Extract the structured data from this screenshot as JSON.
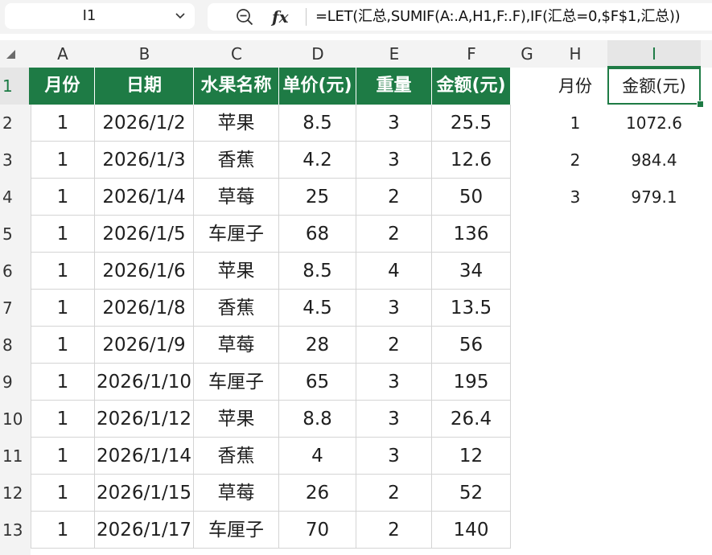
{
  "name_box": {
    "value": "I1"
  },
  "formula_bar": {
    "fx_label": "fx",
    "formula": "=LET(汇总,SUMIF(A:.A,H1,F:.F),IF(汇总=0,$F$1,汇总))"
  },
  "columns": [
    "A",
    "B",
    "C",
    "D",
    "E",
    "F",
    "G",
    "H",
    "I"
  ],
  "active_column": "I",
  "rows": [
    "1",
    "2",
    "3",
    "4",
    "5",
    "6",
    "7",
    "8",
    "9",
    "10",
    "11",
    "12",
    "13"
  ],
  "active_row": "1",
  "table": {
    "headers": [
      "月份",
      "日期",
      "水果名称",
      "单价(元)",
      "重量",
      "金额(元)"
    ],
    "rows": [
      [
        "1",
        "2026/1/2",
        "苹果",
        "8.5",
        "3",
        "25.5"
      ],
      [
        "1",
        "2026/1/3",
        "香蕉",
        "4.2",
        "3",
        "12.6"
      ],
      [
        "1",
        "2026/1/4",
        "草莓",
        "25",
        "2",
        "50"
      ],
      [
        "1",
        "2026/1/5",
        "车厘子",
        "68",
        "2",
        "136"
      ],
      [
        "1",
        "2026/1/6",
        "苹果",
        "8.5",
        "4",
        "34"
      ],
      [
        "1",
        "2026/1/8",
        "香蕉",
        "4.5",
        "3",
        "13.5"
      ],
      [
        "1",
        "2026/1/9",
        "草莓",
        "28",
        "2",
        "56"
      ],
      [
        "1",
        "2026/1/10",
        "车厘子",
        "65",
        "3",
        "195"
      ],
      [
        "1",
        "2026/1/12",
        "苹果",
        "8.8",
        "3",
        "26.4"
      ],
      [
        "1",
        "2026/1/14",
        "香蕉",
        "4",
        "3",
        "12"
      ],
      [
        "1",
        "2026/1/15",
        "草莓",
        "26",
        "2",
        "52"
      ],
      [
        "1",
        "2026/1/17",
        "车厘子",
        "70",
        "2",
        "140"
      ]
    ]
  },
  "summary": {
    "headers": [
      "月份",
      "金额(元)"
    ],
    "rows": [
      [
        "1",
        "1072.6"
      ],
      [
        "2",
        "984.4"
      ],
      [
        "3",
        "979.1"
      ]
    ]
  },
  "colors": {
    "header_fill": "#1e7b45",
    "header_text": "#ffffff",
    "selection": "#1e7b45"
  },
  "icons": {
    "name_box_dropdown": "chevron-down-icon",
    "zoom": "zoom-out-icon",
    "select_all": "select-all-triangle-icon"
  }
}
